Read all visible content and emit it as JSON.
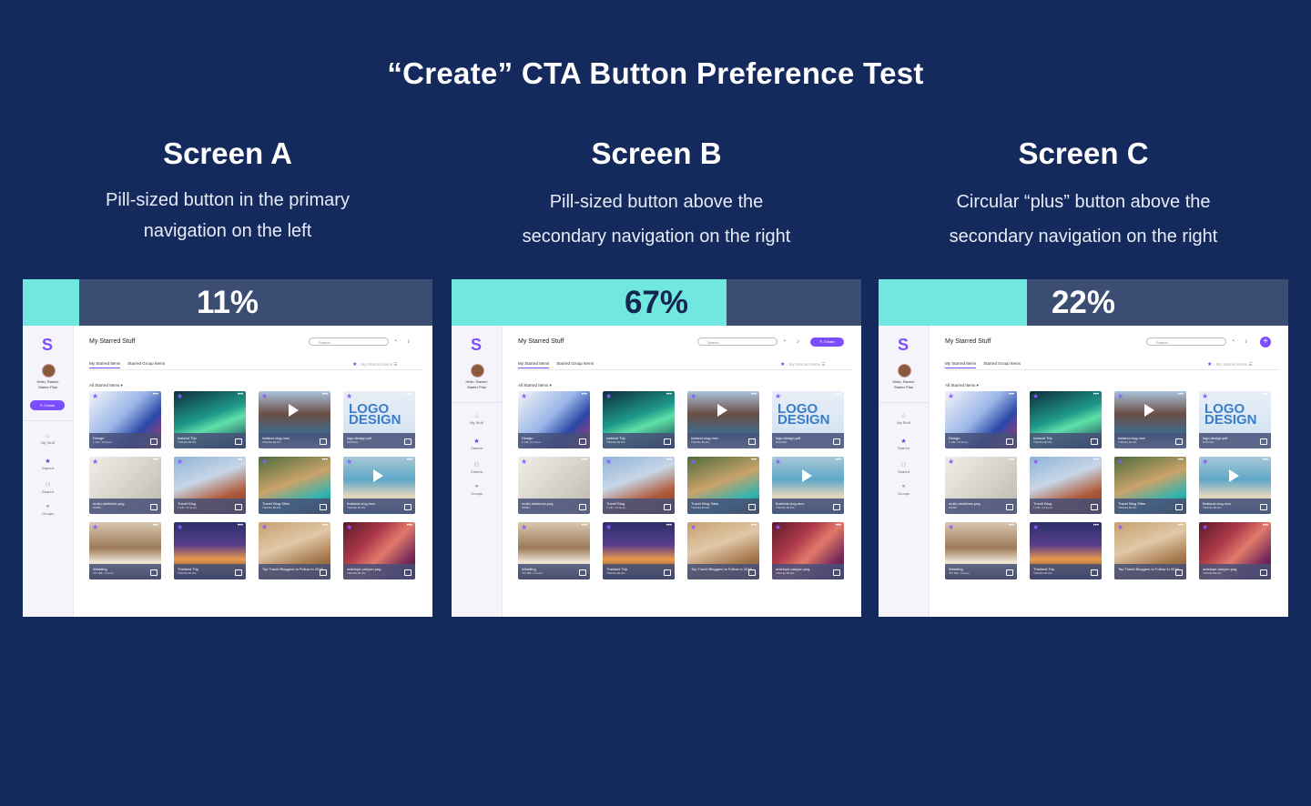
{
  "title": "“Create” CTA Button Preference Test",
  "screens": [
    {
      "name": "Screen A",
      "desc": [
        "Pill-sized button in the primary",
        "navigation on the left"
      ],
      "percent_value": 11,
      "percent_label": "11%",
      "create_style": "pill-left"
    },
    {
      "name": "Screen B",
      "desc": [
        "Pill-sized button above the",
        "secondary navigation on the right"
      ],
      "percent_value": 67,
      "percent_label": "67%",
      "create_style": "pill-right"
    },
    {
      "name": "Screen C",
      "desc": [
        "Circular “plus” button above the",
        "secondary navigation on the right"
      ],
      "percent_value": 22,
      "percent_label": "22%",
      "create_style": "plus-right"
    }
  ],
  "app": {
    "greeting": "Hello, Raven!",
    "plan": "Starter Plan",
    "create_label": "Create",
    "plus_label": "+",
    "nav": [
      "My Stuff",
      "Starred",
      "Shared",
      "Groups"
    ],
    "page_title": "My Starred Stuff",
    "search_placeholder": "Search",
    "tabs": [
      "My Starred Items",
      "Starred Group Items"
    ],
    "breadcrumb": "My Starred Items",
    "filter": "All Starred Items ▾",
    "cards": [
      {
        "title": "Design",
        "sub": "1 GB • 13 items",
        "bg": "linear-gradient(135deg,#f4f4f8 0%,#9ab6e8 45%,#2b48a8 70%,#c03a6a 100%)"
      },
      {
        "title": "Iceland Trip",
        "sub": "TRAVEL BLOG",
        "bg": "linear-gradient(160deg,#0d2c3d 0%,#1f9a8a 45%,#5fe0a8 60%,#0f2b4a 100%)"
      },
      {
        "title": "iceland-vlog.mov",
        "sub": "TRAVEL BLOG",
        "bg": "linear-gradient(180deg,#a9c3db 0%,#6b4e46 40%,#3d6d8c 75%,#d7e6ef 100%)",
        "play": true
      },
      {
        "title": "logo-design.pdf",
        "sub": "SCHOOL",
        "bg": "linear-gradient(180deg,#e8eff7 0%,#cfe0f0 100%)",
        "logo": "LOGO DESIGN"
      },
      {
        "title": "mulio-sketches.png",
        "sub": "WORK",
        "bg": "linear-gradient(135deg,#f0eee8 0%,#d8d4cc 50%,#bdb8ae 100%)"
      },
      {
        "title": "Travel Blog",
        "sub": "1 GB • 13 items",
        "bg": "linear-gradient(160deg,#8fb3d9 0%,#c7d6e6 40%,#b05a3a 70%,#7a3b2a 100%)"
      },
      {
        "title": "Travel Blog Sites",
        "sub": "TRAVEL BLOG",
        "bg": "linear-gradient(160deg,#4d6b3c 0%,#c9a36a 45%,#2fb3b0 75%,#3c5a2a 100%)"
      },
      {
        "title": "thailand-vlog.mov",
        "sub": "TRAVEL BLOG",
        "bg": "linear-gradient(180deg,#a8c8d8 0%,#5fa7c8 40%,#e8d7bc 70%,#5a8fb0 100%)",
        "play": true
      },
      {
        "title": "Wedding",
        "sub": "767 MB • 3 items",
        "bg": "linear-gradient(180deg,#d8c7b0 0%,#9b7a5a 45%,#f0e6d8 70%,#5a4a3a 100%)"
      },
      {
        "title": "Thailand Trip",
        "sub": "TRAVEL BLOG",
        "bg": "linear-gradient(180deg,#2a2f6a 0%,#5a3d8a 40%,#e89a4a 65%,#1a1f3a 100%)"
      },
      {
        "title": "Top Travel Bloggers to Follow in 2018",
        "sub": "",
        "bg": "linear-gradient(160deg,#c8a070 0%,#e0c8a8 40%,#a87a50 70%,#6a4a30 100%)"
      },
      {
        "title": "antelope-canyon.png",
        "sub": "TRAVEL BLOG",
        "bg": "linear-gradient(135deg,#5a1a2a 0%,#b03a4a 35%,#e07a6a 55%,#7a2a5a 80%,#3a1a3a 100%)"
      }
    ]
  }
}
